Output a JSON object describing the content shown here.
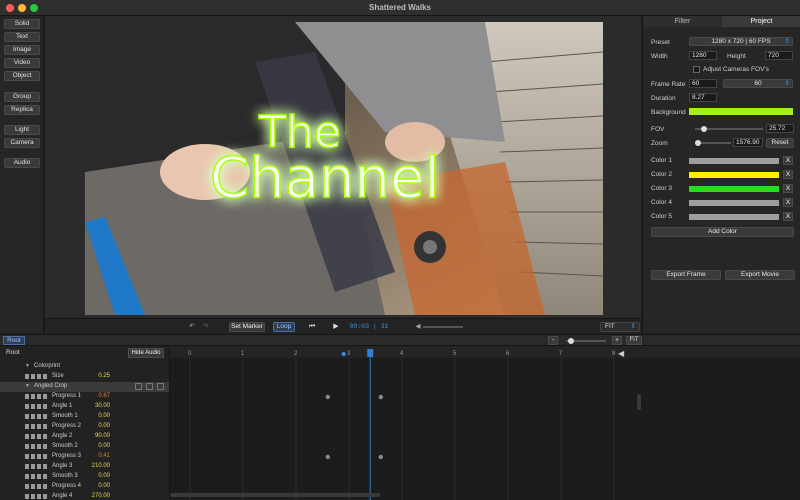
{
  "window": {
    "title": "Shattered Walks"
  },
  "toolbox": [
    "Solid",
    "Text",
    "Image",
    "Video",
    "Object",
    "Group",
    "Replica",
    "Light",
    "Camera",
    "Audio"
  ],
  "canvas": {
    "overlay_text_top": "The",
    "overlay_text_main": "Channel",
    "glow_color": "#a8ff00"
  },
  "transport": {
    "set_marker": "Set Marker",
    "loop": "Loop",
    "time": "00:03 | 31",
    "zoom_mode": "FIT"
  },
  "panel": {
    "tabs": [
      "Filter",
      "Project"
    ],
    "active_tab": "Project",
    "preset_label": "Preset",
    "preset_value": "1280 x 720 | 60 FPS",
    "width_label": "Width",
    "width_value": "1280",
    "height_label": "Height",
    "height_value": "720",
    "adjust_fov": "Adjust Cameras FOV's",
    "frame_rate_label": "Frame Rate",
    "frame_rate_value": "60",
    "frame_rate_select": "60",
    "duration_label": "Duration",
    "duration_value": "8.27",
    "background_label": "Background",
    "background_color": "#a2f21a",
    "fov_label": "FOV",
    "fov_value": "25.72",
    "zoom_label": "Zoom",
    "zoom_value": "1576.90",
    "reset": "Reset",
    "colors": [
      {
        "label": "Color 1",
        "hex": "#9e9e9e"
      },
      {
        "label": "Color 2",
        "hex": "#ffee00"
      },
      {
        "label": "Color 3",
        "hex": "#22e01a"
      },
      {
        "label": "Color 4",
        "hex": "#9e9e9e"
      },
      {
        "label": "Color 5",
        "hex": "#9e9e9e"
      }
    ],
    "x_label": "X",
    "add_color": "Add Color",
    "export_frame": "Export Frame",
    "export_movie": "Export Movie"
  },
  "bottom": {
    "root_tab": "Root",
    "root_label": "Root",
    "hide_audio": "Hide Audio",
    "fit": "FIT",
    "minus": "-",
    "plus": "+"
  },
  "layers": [
    {
      "name": "Colorprint",
      "value": "",
      "group": true
    },
    {
      "name": "Size",
      "value": "0.25",
      "color": "#e8d64a"
    },
    {
      "name": "Angled Crop",
      "value": "",
      "group": true,
      "selected": true
    },
    {
      "name": "Progress 1",
      "value": "0.67",
      "color": "#e07a3a"
    },
    {
      "name": "Angle 1",
      "value": "30.00",
      "color": "#e8d64a"
    },
    {
      "name": "Smooth 1",
      "value": "0.00",
      "color": "#e8d64a"
    },
    {
      "name": "Progress 2",
      "value": "0.00",
      "color": "#e8d64a"
    },
    {
      "name": "Angle 2",
      "value": "90.00",
      "color": "#e8d64a"
    },
    {
      "name": "Smooth 2",
      "value": "0.00",
      "color": "#e8d64a"
    },
    {
      "name": "Progress 3",
      "value": "0.41",
      "color": "#e07a3a"
    },
    {
      "name": "Angle 3",
      "value": "210.00",
      "color": "#e8d64a"
    },
    {
      "name": "Smooth 3",
      "value": "0.00",
      "color": "#e8d64a"
    },
    {
      "name": "Progress 4",
      "value": "0.00",
      "color": "#e8d64a"
    },
    {
      "name": "Angle 4",
      "value": "270.00",
      "color": "#e8d64a"
    }
  ],
  "timeline": {
    "ticks": [
      "0",
      "1",
      "2",
      "3",
      "4",
      "5",
      "6",
      "7",
      "8"
    ],
    "playhead_seconds": 3.4,
    "marker_seconds": 2.9,
    "keyframes": [
      {
        "row": 3,
        "t": 2.6
      },
      {
        "row": 3,
        "t": 3.6
      },
      {
        "row": 9,
        "t": 2.6
      },
      {
        "row": 9,
        "t": 3.6
      }
    ]
  }
}
